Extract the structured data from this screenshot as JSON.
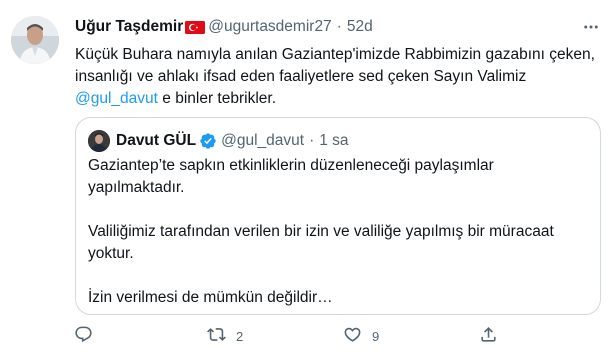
{
  "tweet": {
    "author_name": "Uğur Taşdemir",
    "handle": "@ugurtasdemir27",
    "separator": "·",
    "time": "52d",
    "text_line1": "Küçük Buhara namıyla anılan Gaziantep'imizde Rabbimizin gazabını çeken,",
    "text_line2": "insanlığı ve ahlakı ifsad eden faaliyetlere sed çeken Sayın Valimiz",
    "mention": "@gul_davut",
    "text_line3_rest": " e binler tebrikler.",
    "flag_icon": "turkey-flag-icon"
  },
  "quote": {
    "author_name": "Davut GÜL",
    "handle": "@gul_davut",
    "separator": "·",
    "time": "1 sa",
    "paragraph1_line1": "Gaziantep’te sapkın etkinliklerin düzenleneceği  paylaşımlar",
    "paragraph1_line2": "yapılmaktadır.",
    "paragraph2_line1": "Valiliğimiz tarafından verilen bir izin ve  valiliğe yapılmış bir müracaat",
    "paragraph2_line2": "yoktur.",
    "paragraph3_line1": "İzin verilmesi de mümkün değildir…",
    "verified_icon": "verified-badge-icon"
  },
  "actions": {
    "reply_count": "",
    "retweet_count": "2",
    "like_count": "9",
    "share_count": ""
  },
  "colors": {
    "text": "#0f1419",
    "muted": "#536471",
    "link": "#1d9bf0",
    "border": "#cfd9de",
    "flag_red": "#e30a17"
  }
}
